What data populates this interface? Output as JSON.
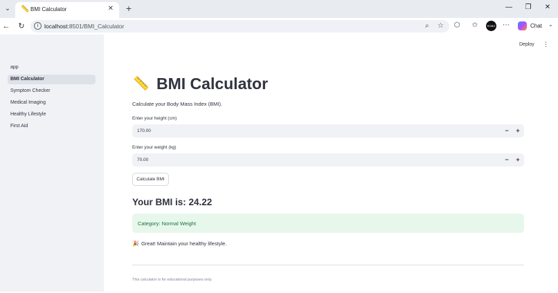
{
  "browser": {
    "tab_title": "BMI Calculator",
    "tab_favicon": "📏",
    "url_host": "localhost",
    "url_path": ":8501/BMI_Calculator",
    "profile_initials": "ROBO",
    "chat_label": "Chat"
  },
  "header": {
    "deploy_label": "Deploy"
  },
  "sidebar": {
    "items": [
      {
        "label": "app",
        "active": false
      },
      {
        "label": "BMI Calculator",
        "active": true
      },
      {
        "label": "Symptom Checker",
        "active": false
      },
      {
        "label": "Medical Imaging",
        "active": false
      },
      {
        "label": "Healthy Lifestyle",
        "active": false
      },
      {
        "label": "First Aid",
        "active": false
      }
    ]
  },
  "main": {
    "title_icon": "📏",
    "title": "BMI Calculator",
    "description": "Calculate your Body Mass Index (BMI).",
    "height": {
      "label": "Enter your height (cm)",
      "value": "170.00"
    },
    "weight": {
      "label": "Enter your weight (kg)",
      "value": "70.00"
    },
    "minus_symbol": "−",
    "plus_symbol": "+",
    "calculate_button": "Calculate BMI",
    "result": "Your BMI is: 24.22",
    "category": "Category: Normal Weight",
    "category_color": "#177233",
    "tip_icon": "🎉",
    "tip": "Great! Maintain your healthy lifestyle.",
    "footer": "This calculator is for educational purposes only."
  }
}
